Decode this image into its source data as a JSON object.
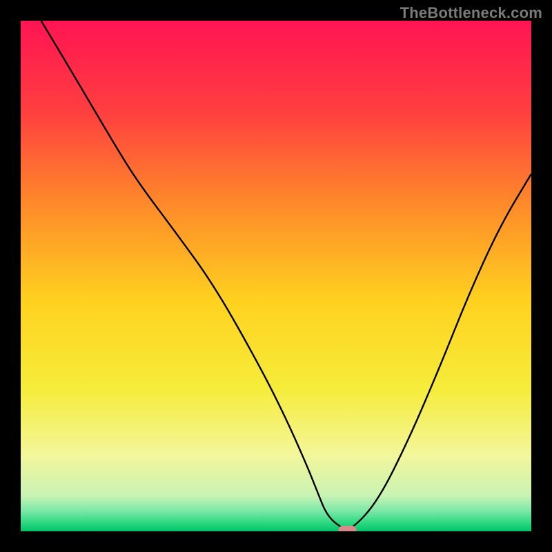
{
  "attribution": "TheBottleneck.com",
  "chart_data": {
    "type": "line",
    "title": "",
    "xlabel": "",
    "ylabel": "",
    "xlim": [
      0,
      100
    ],
    "ylim": [
      0,
      100
    ],
    "grid": false,
    "legend": false,
    "background": {
      "type": "vertical-gradient",
      "stops": [
        {
          "pos": 0.0,
          "color": "#ff1453"
        },
        {
          "pos": 0.18,
          "color": "#ff3f3f"
        },
        {
          "pos": 0.36,
          "color": "#ff8a2a"
        },
        {
          "pos": 0.55,
          "color": "#ffd21f"
        },
        {
          "pos": 0.72,
          "color": "#f6ec3a"
        },
        {
          "pos": 0.85,
          "color": "#f3f69a"
        },
        {
          "pos": 0.93,
          "color": "#c9f3b3"
        },
        {
          "pos": 0.96,
          "color": "#7be8a7"
        },
        {
          "pos": 0.985,
          "color": "#28d77e"
        },
        {
          "pos": 1.0,
          "color": "#00c36a"
        }
      ]
    },
    "series": [
      {
        "name": "bottleneck-curve",
        "color": "#000000",
        "x": [
          4,
          10,
          20,
          24,
          30,
          38,
          47,
          52,
          56,
          58,
          60,
          63,
          65,
          70,
          76,
          82,
          88,
          94,
          100
        ],
        "y": [
          100,
          90,
          73,
          67,
          59,
          48,
          32,
          22,
          13,
          8,
          3,
          0.5,
          0.5,
          6,
          18,
          32,
          47,
          60,
          70
        ]
      }
    ],
    "marker": {
      "name": "optimal-point",
      "x": 64,
      "y": 0,
      "color": "#d98b8b",
      "shape": "rounded-pill"
    }
  },
  "colors": {
    "page_bg": "#000000",
    "curve": "#000000",
    "marker": "#d98b8b"
  }
}
